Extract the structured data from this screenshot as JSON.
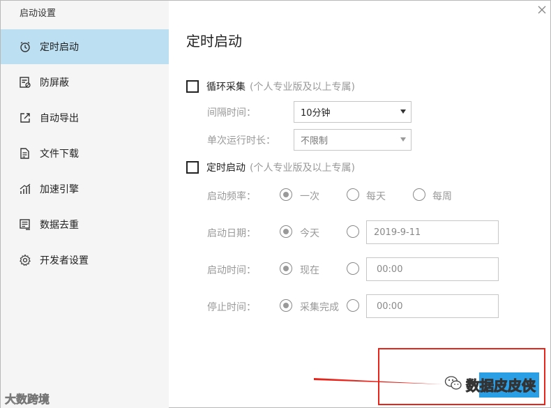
{
  "window": {
    "title": "启动设置"
  },
  "sidebar": {
    "items": [
      {
        "label": "定时启动",
        "icon": "alarm-clock-icon",
        "active": true
      },
      {
        "label": "防屏蔽",
        "icon": "shield-doc-icon",
        "active": false
      },
      {
        "label": "自动导出",
        "icon": "export-icon",
        "active": false
      },
      {
        "label": "文件下载",
        "icon": "file-download-icon",
        "active": false
      },
      {
        "label": "加速引擎",
        "icon": "speed-chart-icon",
        "active": false
      },
      {
        "label": "数据去重",
        "icon": "dedupe-icon",
        "active": false
      },
      {
        "label": "开发者设置",
        "icon": "gear-icon",
        "active": false
      }
    ]
  },
  "main": {
    "title": "定时启动",
    "loop_collect": {
      "label": "循环采集",
      "note": "(个人专业版及以上专属)",
      "checked": false,
      "interval_label": "间隔时间：",
      "interval_value": "10分钟",
      "duration_label": "单次运行时长：",
      "duration_value": "不限制"
    },
    "scheduled": {
      "label": "定时启动",
      "note": "(个人专业版及以上专属)",
      "checked": false,
      "frequency_label": "启动频率：",
      "frequency_options": [
        "一次",
        "每天",
        "每周"
      ],
      "frequency_selected": "一次",
      "date_label": "启动日期：",
      "date_option": "今天",
      "date_value": "2019-9-11",
      "time_label": "启动时间：",
      "time_option": "现在",
      "time_value": "00:00",
      "stop_label": "停止时间：",
      "stop_option": "采集完成",
      "stop_value": "00:00"
    }
  },
  "watermark": {
    "text": "数据皮皮侠",
    "bottom_text": "大数跨境"
  },
  "colors": {
    "sidebar_bg": "#f5f5f5",
    "active_item": "#bcdff2",
    "primary_button": "#2b9fe6",
    "highlight_box": "#e8231a"
  }
}
